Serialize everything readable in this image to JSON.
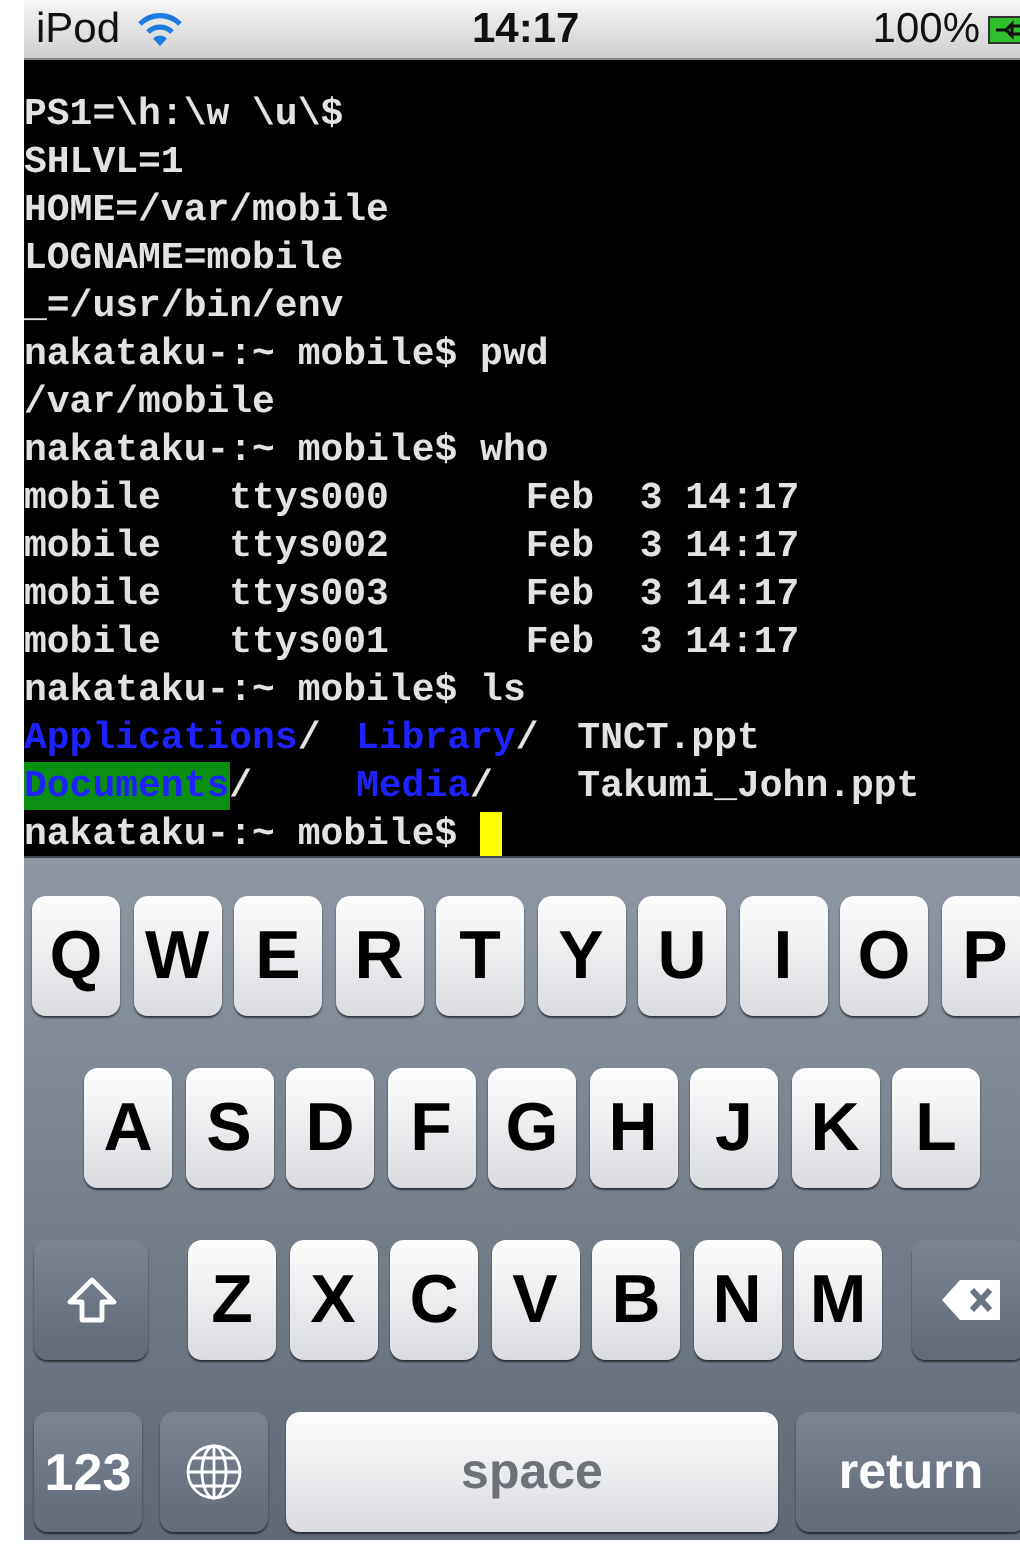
{
  "status_bar": {
    "carrier": "iPod",
    "time": "14:17",
    "battery": "100%"
  },
  "terminal": {
    "lines": [
      {
        "kind": "text",
        "text": "PS1=\\h:\\w \\u\\$"
      },
      {
        "kind": "text",
        "text": "SHLVL=1"
      },
      {
        "kind": "text",
        "text": "HOME=/var/mobile"
      },
      {
        "kind": "text",
        "text": "LOGNAME=mobile"
      },
      {
        "kind": "text",
        "text": "_=/usr/bin/env"
      },
      {
        "kind": "text",
        "text": "nakataku-:~ mobile$ pwd"
      },
      {
        "kind": "text",
        "text": "/var/mobile"
      },
      {
        "kind": "text",
        "text": "nakataku-:~ mobile$ who"
      },
      {
        "kind": "text",
        "text": "mobile   ttys000      Feb  3 14:17"
      },
      {
        "kind": "text",
        "text": "mobile   ttys002      Feb  3 14:17"
      },
      {
        "kind": "text",
        "text": "mobile   ttys003      Feb  3 14:17"
      },
      {
        "kind": "text",
        "text": "mobile   ttys001      Feb  3 14:17"
      },
      {
        "kind": "text",
        "text": "nakataku-:~ mobile$ ls"
      },
      {
        "kind": "ls",
        "entries": [
          {
            "name": "Applications",
            "suffix": "/",
            "kind": "directory",
            "highlighted": false
          },
          {
            "name": "Library",
            "suffix": "/",
            "kind": "directory",
            "highlighted": false
          },
          {
            "name": "TNCT.ppt",
            "kind": "file",
            "highlighted": false
          }
        ]
      },
      {
        "kind": "ls",
        "entries": [
          {
            "name": "Documents",
            "suffix": "/",
            "kind": "directory",
            "highlighted": true
          },
          {
            "name": "Media",
            "suffix": "/",
            "kind": "directory",
            "highlighted": false
          },
          {
            "name": "Takumi_John.ppt",
            "kind": "file",
            "highlighted": false
          }
        ]
      },
      {
        "kind": "prompt",
        "text": "nakataku-:~ mobile$",
        "cursor": true
      }
    ]
  },
  "keyboard": {
    "top_row": [
      {
        "kind": "letter",
        "label": "Q"
      },
      {
        "kind": "letter",
        "label": "W"
      },
      {
        "kind": "letter",
        "label": "E"
      },
      {
        "kind": "letter",
        "label": "R"
      },
      {
        "kind": "letter",
        "label": "T"
      },
      {
        "kind": "letter",
        "label": "Y"
      },
      {
        "kind": "letter",
        "label": "U"
      },
      {
        "kind": "letter",
        "label": "I"
      },
      {
        "kind": "letter",
        "label": "O"
      },
      {
        "kind": "letter",
        "label": "P"
      }
    ],
    "middle_row": [
      {
        "kind": "letter",
        "label": "A"
      },
      {
        "kind": "letter",
        "label": "S"
      },
      {
        "kind": "letter",
        "label": "D"
      },
      {
        "kind": "letter",
        "label": "F"
      },
      {
        "kind": "letter",
        "label": "G"
      },
      {
        "kind": "letter",
        "label": "H"
      },
      {
        "kind": "letter",
        "label": "J"
      },
      {
        "kind": "letter",
        "label": "K"
      },
      {
        "kind": "letter",
        "label": "L"
      }
    ],
    "bottom_row": [
      {
        "kind": "shift"
      },
      {
        "kind": "letter",
        "label": "Z"
      },
      {
        "kind": "letter",
        "label": "X"
      },
      {
        "kind": "letter",
        "label": "C"
      },
      {
        "kind": "letter",
        "label": "V"
      },
      {
        "kind": "letter",
        "label": "B"
      },
      {
        "kind": "letter",
        "label": "N"
      },
      {
        "kind": "letter",
        "label": "M"
      },
      {
        "kind": "delete"
      }
    ],
    "function_row": [
      {
        "kind": "mode",
        "label": "123"
      },
      {
        "kind": "globe"
      },
      {
        "kind": "space",
        "label": "space"
      },
      {
        "kind": "return",
        "label": "return"
      }
    ]
  }
}
